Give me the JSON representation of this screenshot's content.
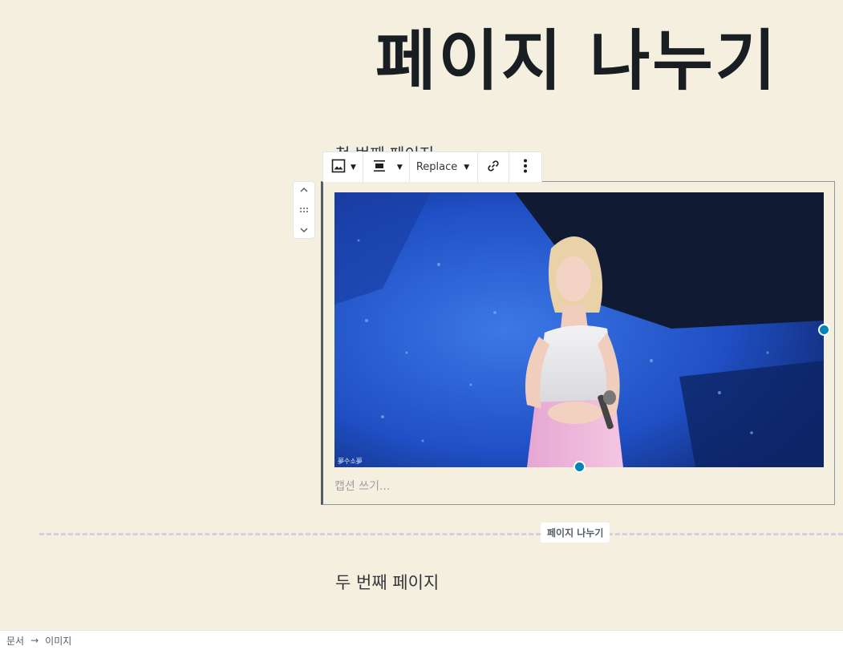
{
  "document": {
    "title": "페이지 나누기",
    "paragraph_behind_toolbar": "첫 번째 페이지",
    "second_page_text": "두 번째 페이지"
  },
  "block_mover": {
    "up_icon": "chevron-up-icon",
    "drag_icon": "drag-handle-icon",
    "down_icon": "chevron-down-icon"
  },
  "toolbar": {
    "block_type_icon": "image-icon",
    "align_icon": "align-center-icon",
    "replace_label": "Replace",
    "link_icon": "link-icon",
    "more_icon": "more-vertical-icon"
  },
  "image_block": {
    "watermark_text": "夢수소夢",
    "caption_placeholder": "캡션 쓰기..."
  },
  "page_break": {
    "label": "페이지 나누기"
  },
  "breadcrumb": {
    "items": [
      "문서",
      "이미지"
    ],
    "separator": "→"
  },
  "colors": {
    "background": "#f5efe0",
    "handle": "#0085ba",
    "border_dark": "#555d66"
  }
}
